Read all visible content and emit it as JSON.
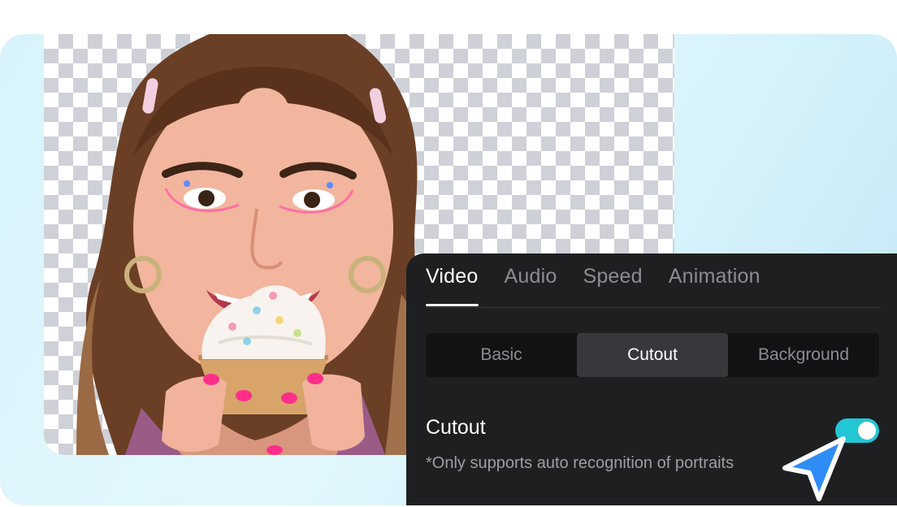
{
  "tabs": [
    {
      "label": "Video",
      "active": true
    },
    {
      "label": "Audio",
      "active": false
    },
    {
      "label": "Speed",
      "active": false
    },
    {
      "label": "Animation",
      "active": false
    }
  ],
  "segments": [
    {
      "label": "Basic",
      "active": false
    },
    {
      "label": "Cutout",
      "active": true
    },
    {
      "label": "Background",
      "active": false
    }
  ],
  "cutout": {
    "label": "Cutout",
    "note": "*Only supports auto recognition of portraits",
    "toggle_on": true
  },
  "colors": {
    "panel_bg": "#1e1f21",
    "toggle_accent": "#23c6d3",
    "cursor_fill": "#2f8cf6"
  },
  "icons": [
    "pointer-cursor-icon"
  ]
}
